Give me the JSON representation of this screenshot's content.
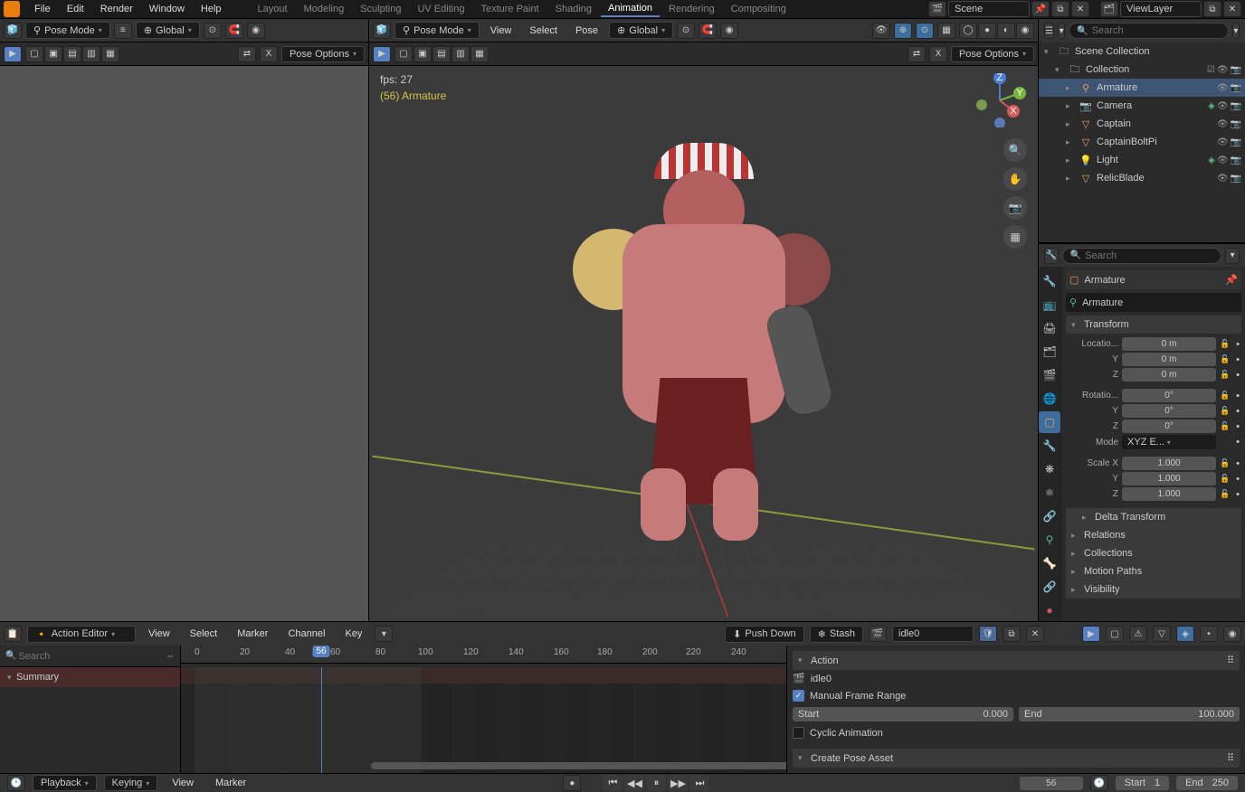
{
  "topbar": {
    "menus": [
      "File",
      "Edit",
      "Render",
      "Window",
      "Help"
    ],
    "workspaces": [
      "Layout",
      "Modeling",
      "Sculpting",
      "UV Editing",
      "Texture Paint",
      "Shading",
      "Animation",
      "Rendering",
      "Compositing"
    ],
    "active_workspace": "Animation",
    "scene_label": "Scene",
    "viewlayer_label": "ViewLayer"
  },
  "viewport_header": {
    "mode": "Pose Mode",
    "orientation": "Global",
    "view_menu": "View",
    "select_menu": "Select",
    "pose_menu": "Pose"
  },
  "viewport": {
    "fps": "fps: 27",
    "selection": "(56) Armature",
    "pose_options": "Pose Options"
  },
  "outliner": {
    "root": "Scene Collection",
    "collection": "Collection",
    "items": [
      {
        "name": "Armature",
        "icon": "armature",
        "selected": true
      },
      {
        "name": "Camera",
        "icon": "camera"
      },
      {
        "name": "Captain",
        "icon": "mesh"
      },
      {
        "name": "CaptainBoltPi",
        "icon": "mesh"
      },
      {
        "name": "Light",
        "icon": "light"
      },
      {
        "name": "RelicBlade",
        "icon": "mesh"
      }
    ],
    "search_placeholder": "Search"
  },
  "properties": {
    "breadcrumb": "Armature",
    "datablock": "Armature",
    "search_placeholder": "Search",
    "transform": {
      "title": "Transform",
      "loc_label": "Locatio...",
      "loc_x": "0 m",
      "loc_y": "0 m",
      "loc_z": "0 m",
      "rot_label": "Rotatio...",
      "rot_x": "0°",
      "rot_y": "0°",
      "rot_z": "0°",
      "mode_label": "Mode",
      "mode_val": "XYZ E...",
      "scale_label": "Scale X",
      "scale_x": "1.000",
      "scale_y": "1.000",
      "scale_z": "1.000",
      "y_label": "Y",
      "z_label": "Z"
    },
    "panels": [
      "Delta Transform",
      "Relations",
      "Collections",
      "Motion Paths",
      "Visibility"
    ]
  },
  "action_editor": {
    "editor_type": "Action Editor",
    "menus": [
      "View",
      "Select",
      "Marker",
      "Channel",
      "Key"
    ],
    "push_down": "Push Down",
    "stash": "Stash",
    "action_name": "idle0",
    "search_placeholder": "Search",
    "summary": "Summary",
    "ruler": [
      "0",
      "20",
      "40",
      "60",
      "80",
      "100",
      "120",
      "140",
      "160",
      "180",
      "200",
      "220",
      "240"
    ],
    "current_frame": "56",
    "side": {
      "action_title": "Action",
      "action_name": "idle0",
      "manual_range": "Manual Frame Range",
      "start_label": "Start",
      "start_val": "0.000",
      "end_label": "End",
      "end_val": "100.000",
      "cyclic": "Cyclic Animation",
      "create_pose": "Create Pose Asset"
    }
  },
  "timeline_footer": {
    "menus": [
      "Playback",
      "Keying",
      "View",
      "Marker"
    ],
    "frame": "56",
    "start_label": "Start",
    "start_val": "1",
    "end_label": "End",
    "end_val": "250"
  }
}
